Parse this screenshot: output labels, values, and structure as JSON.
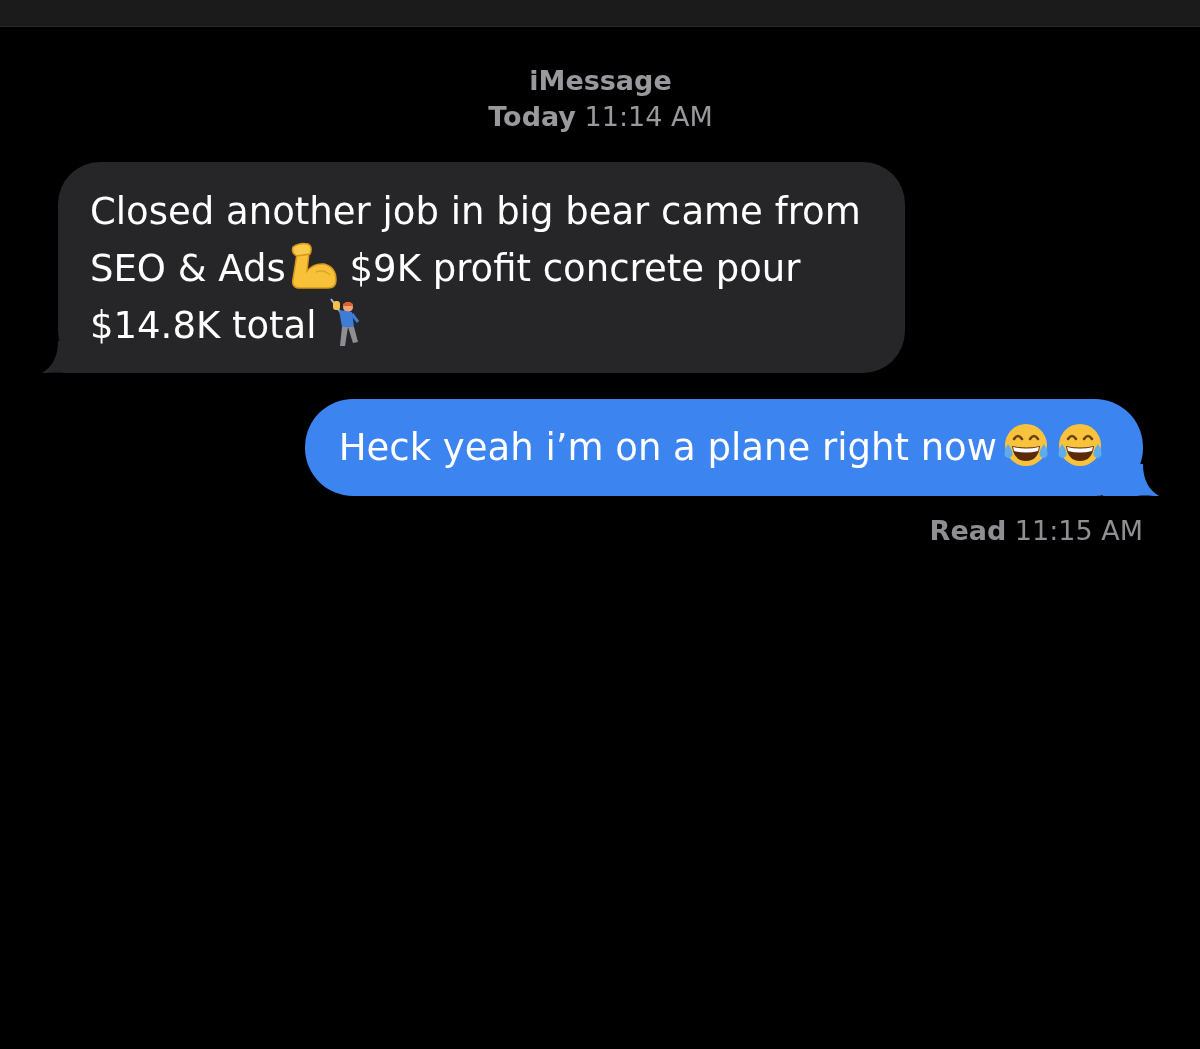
{
  "header": {
    "service": "iMessage",
    "timestamp": "**Today** 11:14 AM"
  },
  "messages": [
    {
      "kind": "incoming",
      "parts": [
        {
          "kind": "text",
          "text": "Closed another job in big bear came from SEO & Ads"
        },
        {
          "kind": "biceps"
        },
        {
          "kind": "text",
          "text": " $9K profit concrete pour $14.8K total "
        },
        {
          "kind": "golfer"
        }
      ]
    },
    {
      "kind": "outgoing",
      "parts": [
        {
          "kind": "text",
          "text": "Heck yeah i’m on a plane right now"
        },
        {
          "kind": "laughing"
        },
        {
          "kind": "laughing"
        }
      ]
    }
  ],
  "receipt": "**Read** 11:15 AM"
}
